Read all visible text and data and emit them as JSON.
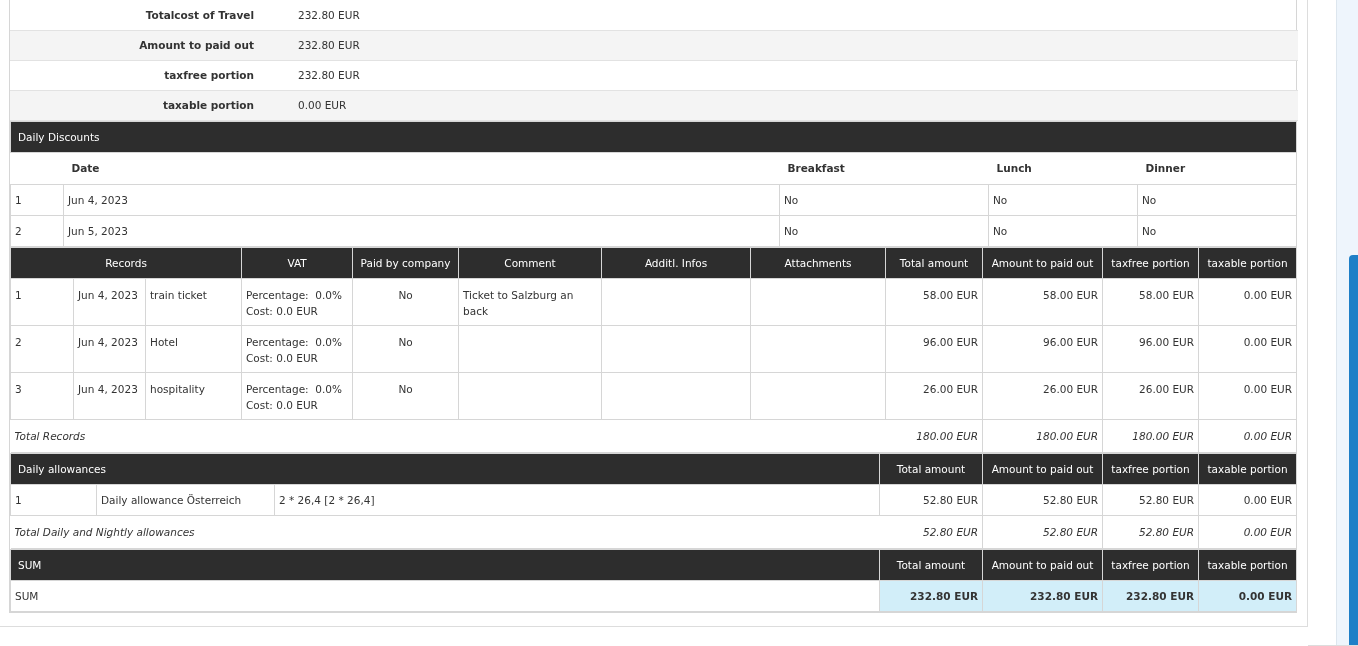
{
  "summary": [
    {
      "label": "Totalcost of Travel",
      "value": "232.80 EUR"
    },
    {
      "label": "Amount to paid out",
      "value": "232.80 EUR"
    },
    {
      "label": "taxfree portion",
      "value": "232.80 EUR"
    },
    {
      "label": "taxable portion",
      "value": "0.00 EUR"
    }
  ],
  "daily_discounts": {
    "title": "Daily Discounts",
    "columns": [
      "Date",
      "Breakfast",
      "Lunch",
      "Dinner"
    ],
    "rows": [
      {
        "index": "1",
        "date": "Jun 4, 2023",
        "breakfast": "No",
        "lunch": "No",
        "dinner": "No"
      },
      {
        "index": "2",
        "date": "Jun 5, 2023",
        "breakfast": "No",
        "lunch": "No",
        "dinner": "No"
      }
    ]
  },
  "records": {
    "columns": [
      "Records",
      "VAT",
      "Paid by company",
      "Comment",
      "Additl. Infos",
      "Attachments",
      "Total amount",
      "Amount to paid out",
      "taxfree portion",
      "taxable portion"
    ],
    "rows": [
      {
        "index": "1",
        "date": "Jun 4, 2023",
        "description": "train ticket",
        "vat_percentage": "Percentage:  0.0%",
        "vat_cost": "Cost: 0.0 EUR",
        "paid_by_company": "No",
        "comment": "Ticket to Salzburg an back",
        "amounts": [
          "58.00 EUR",
          "58.00 EUR",
          "58.00 EUR",
          "0.00 EUR"
        ]
      },
      {
        "index": "2",
        "date": "Jun 4, 2023",
        "description": "Hotel",
        "vat_percentage": "Percentage:  0.0%",
        "vat_cost": "Cost: 0.0 EUR",
        "paid_by_company": "No",
        "amounts": [
          "96.00 EUR",
          "96.00 EUR",
          "96.00 EUR",
          "0.00 EUR"
        ]
      },
      {
        "index": "3",
        "date": "Jun 4, 2023",
        "description": "hospitality",
        "vat_percentage": "Percentage:  0.0%",
        "vat_cost": "Cost: 0.0 EUR",
        "paid_by_company": "No",
        "amounts": [
          "26.00 EUR",
          "26.00 EUR",
          "26.00 EUR",
          "0.00 EUR"
        ]
      }
    ],
    "total": {
      "label": "Total Records",
      "amounts": [
        "180.00 EUR",
        "180.00 EUR",
        "180.00 EUR",
        "0.00 EUR"
      ]
    }
  },
  "allowances": {
    "title": "Daily allowances",
    "columns": [
      "Total amount",
      "Amount to paid out",
      "taxfree portion",
      "taxable portion"
    ],
    "rows": [
      {
        "index": "1",
        "name": "Daily allowance Österreich",
        "formula": "2 * 26,4 [2 * 26,4]",
        "amounts": [
          "52.80 EUR",
          "52.80 EUR",
          "52.80 EUR",
          "0.00 EUR"
        ]
      }
    ],
    "total": {
      "label": "Total Daily and Nightly allowances",
      "amounts": [
        "52.80 EUR",
        "52.80 EUR",
        "52.80 EUR",
        "0.00 EUR"
      ]
    }
  },
  "sum": {
    "title": "SUM",
    "columns": [
      "Total amount",
      "Amount to paid out",
      "taxfree portion",
      "taxable portion"
    ],
    "row": {
      "label": "SUM",
      "amounts": [
        "232.80 EUR",
        "232.80 EUR",
        "232.80 EUR",
        "0.00 EUR"
      ]
    }
  }
}
